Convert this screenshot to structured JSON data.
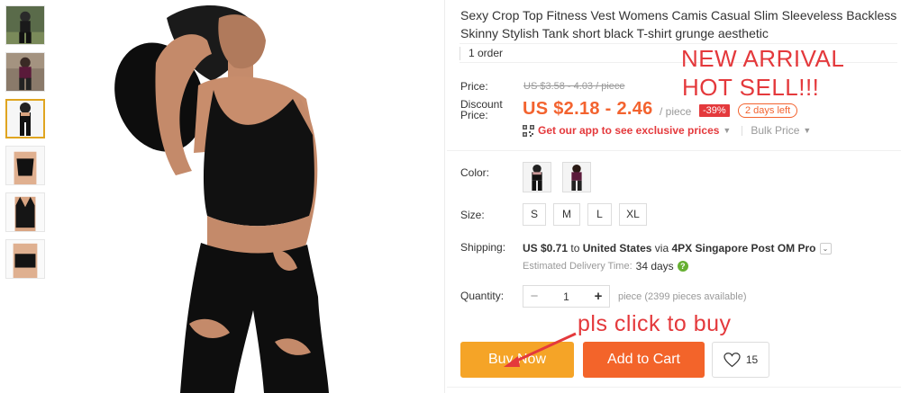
{
  "product": {
    "title": "Sexy Crop Top Fitness Vest Womens Camis Casual Slim Sleeveless Backless Skinny Stylish Tank short black T-shirt grunge aesthetic",
    "orders": "1 order"
  },
  "overlay_text": {
    "new_arrival": "NEW ARRIVAL",
    "hot_sell": "HOT SELL!!!",
    "click_to_buy": "pls click to buy"
  },
  "pricing": {
    "price_label": "Price:",
    "original_price": "US $3.58 - 4.03 / piece",
    "discount_label_1": "Discount",
    "discount_label_2": "Price:",
    "discount_price": "US $2.18 - 2.46",
    "unit": "/ piece",
    "discount_pct": "-39%",
    "time_left": "2 days left",
    "app_promo": "Get our app to see exclusive prices",
    "bulk_price": "Bulk Price"
  },
  "options": {
    "color_label": "Color:",
    "size_label": "Size:",
    "sizes": [
      "S",
      "M",
      "L",
      "XL"
    ]
  },
  "shipping": {
    "label": "Shipping:",
    "cost": "US $0.71",
    "to_word": "to",
    "destination": "United States",
    "via_word": "via",
    "carrier": "4PX Singapore Post OM Pro",
    "delivery_label": "Estimated Delivery Time:",
    "delivery_days": "34 days"
  },
  "quantity": {
    "label": "Quantity:",
    "minus": "−",
    "value": "1",
    "plus": "+",
    "available": "piece (2399 pieces available)"
  },
  "actions": {
    "buy_now": "Buy Now",
    "add_to_cart": "Add to Cart",
    "wishlist_count": "15"
  },
  "colors": {
    "accent_red": "#e4393c",
    "price_orange": "#f3632f",
    "buy_now_bg": "#f5a427",
    "add_cart_bg": "#f3642a",
    "thumb_active": "#e0a520"
  },
  "icons": [
    "qr-code-icon",
    "chevron-down-icon",
    "help-icon",
    "heart-icon",
    "arrow-icon"
  ]
}
